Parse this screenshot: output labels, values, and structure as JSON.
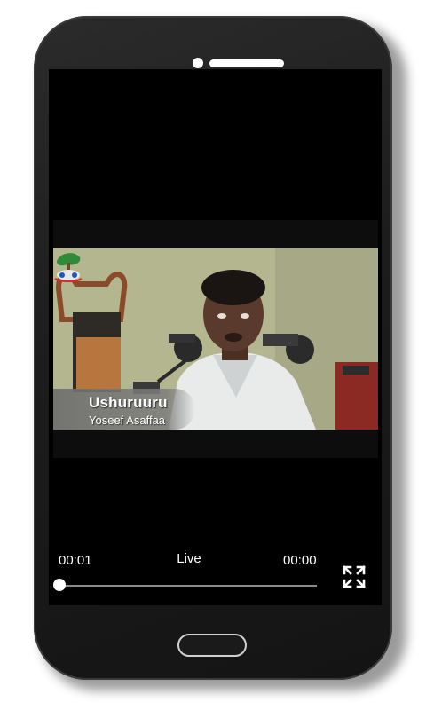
{
  "player": {
    "elapsed_time": "00:01",
    "status_label": "Live",
    "duration": "00:00",
    "progress_fraction": 0.0,
    "fullscreen_icon": "expand-arrows-icon"
  },
  "video": {
    "lower_third_title": "Ushuruuru",
    "lower_third_subtitle": "Yoseef Asaffaa",
    "watermark_icon": "channel-logo-icon"
  },
  "device": {
    "camera_icon": "front-camera-icon",
    "speaker_icon": "earpiece-speaker-icon",
    "home_icon": "home-button-icon"
  },
  "colors": {
    "screen_background": "#000000",
    "text": "#ffffff",
    "seek_track": "#8a8a8a"
  }
}
